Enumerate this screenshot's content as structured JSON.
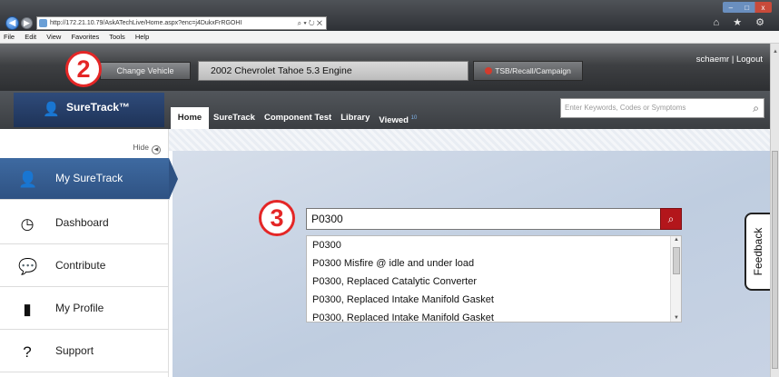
{
  "browser": {
    "address": "http://172.21.10.79/AskATechLive/Home.aspx?enc=j4DukxFrRGOHI",
    "address_controls": "⌕ ▾ ↻ ✕",
    "window_controls": [
      "–",
      "□",
      "x"
    ],
    "toolbar_icons": "⌂ ★ ⚙",
    "menu": [
      "File",
      "Edit",
      "View",
      "Favorites",
      "Tools",
      "Help"
    ]
  },
  "vehicle_bar": {
    "change_vehicle_label": "Change Vehicle",
    "vehicle": "2002 Chevrolet Tahoe 5.3 Engine",
    "tsb_label": "TSB/Recall/Campaign",
    "user": "schaemr",
    "separator": "|",
    "logout": "Logout"
  },
  "steps": {
    "two": "2",
    "three": "3"
  },
  "brand": {
    "name": "SureTrack™"
  },
  "tabs": [
    {
      "label": "Home"
    },
    {
      "label": "SureTrack"
    },
    {
      "label": "Component Test"
    },
    {
      "label": "Library"
    },
    {
      "label": "Viewed",
      "badge": "10"
    }
  ],
  "top_search": {
    "placeholder": "Enter Keywords, Codes or Symptoms"
  },
  "sidebar": {
    "hide_label": "Hide",
    "items": [
      {
        "label": "My SureTrack",
        "icon": "user-tie-icon"
      },
      {
        "label": "Dashboard",
        "icon": "speedometer-icon"
      },
      {
        "label": "Contribute",
        "icon": "chat-user-icon"
      },
      {
        "label": "My Profile",
        "icon": "id-badge-icon"
      },
      {
        "label": "Support",
        "icon": "question-circle-icon"
      }
    ]
  },
  "main_search": {
    "value": "P0300",
    "suggestions": [
      "P0300",
      "P0300 Misfire @ idle and under load",
      "P0300, Replaced Catalytic Converter",
      "P0300, Replaced Intake Manifold Gasket",
      "P0300, Replaced Intake Manifold Gasket"
    ]
  },
  "feedback": {
    "label": "Feedback"
  },
  "colors": {
    "accent_red": "#e42626",
    "brand_blue": "#2f5283",
    "search_button": "#b3161b"
  }
}
